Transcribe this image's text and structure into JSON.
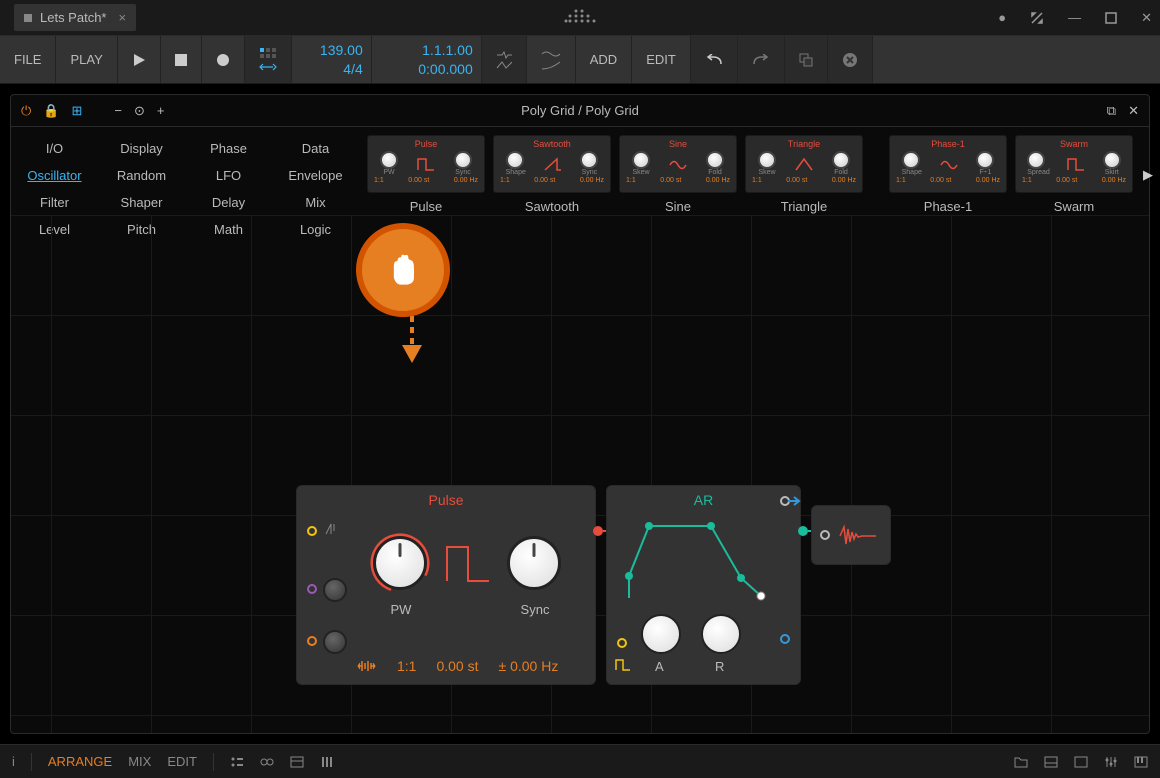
{
  "titlebar": {
    "tab_title": "Lets Patch*",
    "tab_close": "×"
  },
  "toolbar": {
    "file": "FILE",
    "play": "PLAY",
    "tempo": "139.00",
    "timesig": "4/4",
    "position": "1.1.1.00",
    "time": "0:00.000",
    "add": "ADD",
    "edit": "EDIT"
  },
  "panel": {
    "title": "Poly Grid / Poly Grid"
  },
  "categories": [
    [
      "I/O",
      "Display",
      "Phase",
      "Data"
    ],
    [
      "Oscillator",
      "Random",
      "LFO",
      "Envelope"
    ],
    [
      "Filter",
      "Shaper",
      "Delay",
      "Mix"
    ],
    [
      "Level",
      "Pitch",
      "Math",
      "Logic"
    ]
  ],
  "category_selected": "Oscillator",
  "modules": [
    {
      "name": "Pulse",
      "k1": "PW",
      "k2": "Sync",
      "wave": "pulse"
    },
    {
      "name": "Sawtooth",
      "k1": "Shape",
      "k2": "Sync",
      "wave": "saw"
    },
    {
      "name": "Sine",
      "k1": "Skew",
      "k2": "Fold",
      "wave": "sine"
    },
    {
      "name": "Triangle",
      "k1": "Skew",
      "k2": "Fold",
      "wave": "tri"
    },
    {
      "name": "Phase-1",
      "k1": "Shape",
      "k2": "F÷1",
      "wave": "sine"
    },
    {
      "name": "Swarm",
      "k1": "Spread",
      "k2": "Skirt",
      "wave": "pulse"
    }
  ],
  "module_footer": {
    "ratio": "1:1",
    "st": "0.00 st",
    "hz": "0.00 Hz"
  },
  "big_pulse": {
    "title": "Pulse",
    "pw": "PW",
    "sync": "Sync",
    "ratio": "1:1",
    "st": "0.00 st",
    "hz": "± 0.00 Hz"
  },
  "big_ar": {
    "title": "AR",
    "a": "A",
    "r": "R"
  },
  "bottombar": {
    "arrange": "ARRANGE",
    "mix": "MIX",
    "edit": "EDIT"
  }
}
